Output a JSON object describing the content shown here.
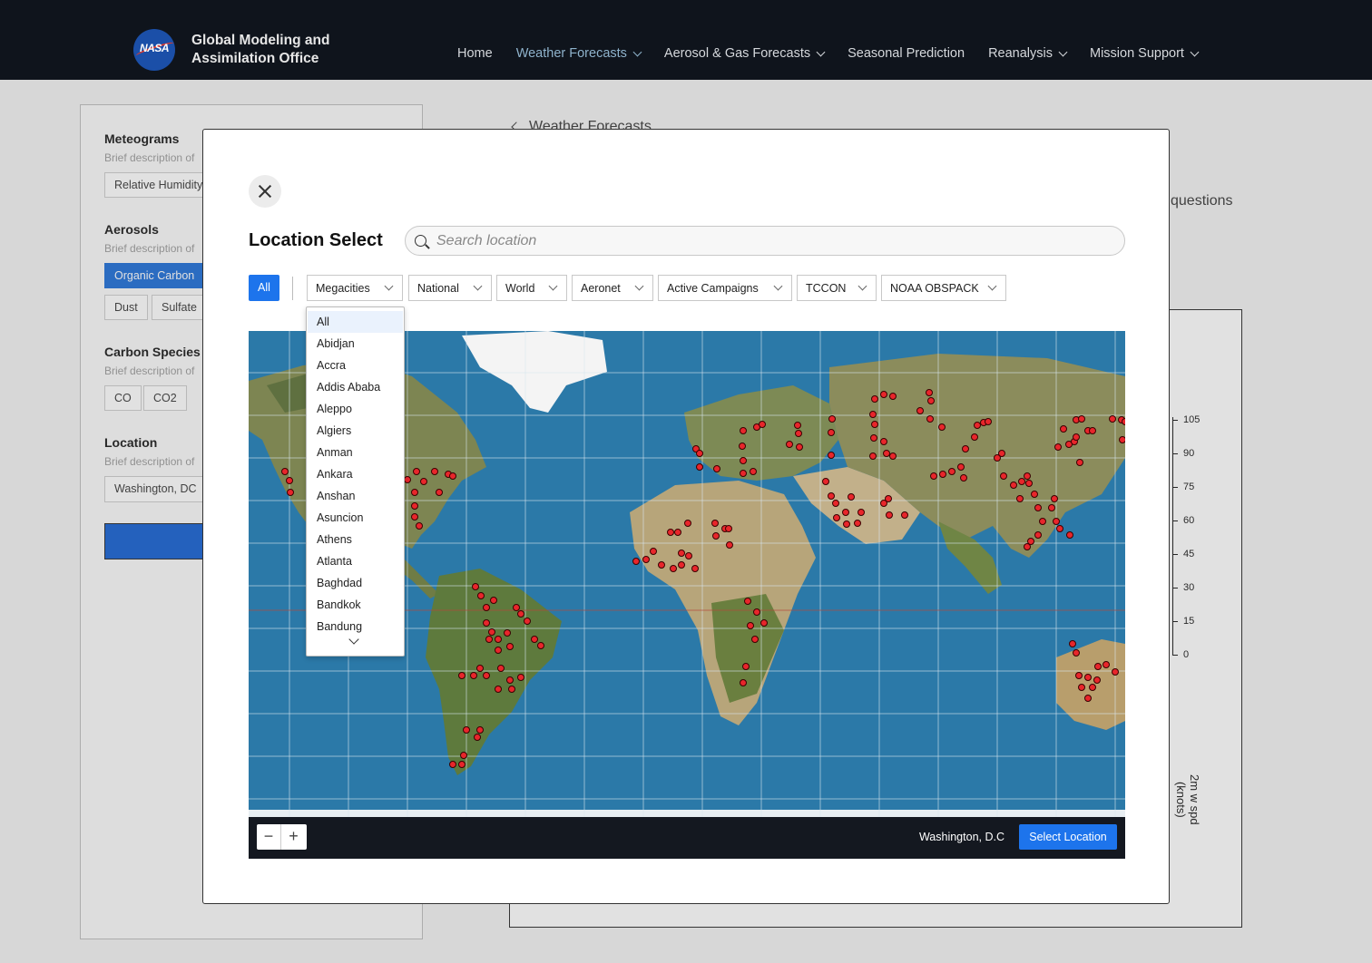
{
  "header": {
    "org_line1": "Global Modeling and",
    "org_line2": "Assimilation Office",
    "logo_text": "NASA",
    "nav": [
      {
        "label": "Home",
        "dropdown": false
      },
      {
        "label": "Weather Forecasts",
        "dropdown": true,
        "active": true
      },
      {
        "label": "Aerosol & Gas Forecasts",
        "dropdown": true
      },
      {
        "label": "Seasonal Prediction",
        "dropdown": false
      },
      {
        "label": "Reanalysis",
        "dropdown": true
      },
      {
        "label": "Mission Support",
        "dropdown": true
      }
    ]
  },
  "background": {
    "breadcrumb": "Weather Forecasts",
    "questions_text": "questions",
    "sections": {
      "meteograms": {
        "title": "Meteograms",
        "desc": "Brief description of",
        "chips": [
          "Relative Humidity"
        ]
      },
      "aerosols": {
        "title": "Aerosols",
        "desc": "Brief description of",
        "chips": [
          "Organic Carbon",
          "Dust",
          "Sulfate"
        ]
      },
      "carbon": {
        "title": "Carbon Species",
        "desc": "Brief description of",
        "chips": [
          "CO",
          "CO2"
        ]
      },
      "location": {
        "title": "Location",
        "desc": "Brief description of",
        "value": "Washington, DC"
      }
    },
    "chart": {
      "yticks": [
        "105",
        "90",
        "75",
        "60",
        "45",
        "30",
        "15",
        "0"
      ],
      "ylabel_line1": "2m w spd",
      "ylabel_line2": "(knots)"
    }
  },
  "modal": {
    "title": "Location Select",
    "search_placeholder": "Search location",
    "filter_all": "All",
    "filters": [
      "Megacities",
      "National",
      "World",
      "Aeronet",
      "Active Campaigns",
      "TCCON",
      "NOAA OBSPACK"
    ],
    "dropdown_items": [
      "All",
      "Abidjan",
      "Accra",
      "Addis Ababa",
      "Aleppo",
      "Algiers",
      "Anman",
      "Ankara",
      "Anshan",
      "Asuncion",
      "Athens",
      "Atlanta",
      "Baghdad",
      "Bandkok",
      "Bandung"
    ],
    "dropdown_selected": "All",
    "selected_location": "Washington, D.C",
    "select_button": "Select Location",
    "zoom_out": "−",
    "zoom_in": "+"
  },
  "colors": {
    "accent": "#1d74ec",
    "marker": "#e8262b",
    "ocean": "#2b79a8",
    "land": "#8a8f5a",
    "nav_bg": "#0f141c"
  }
}
